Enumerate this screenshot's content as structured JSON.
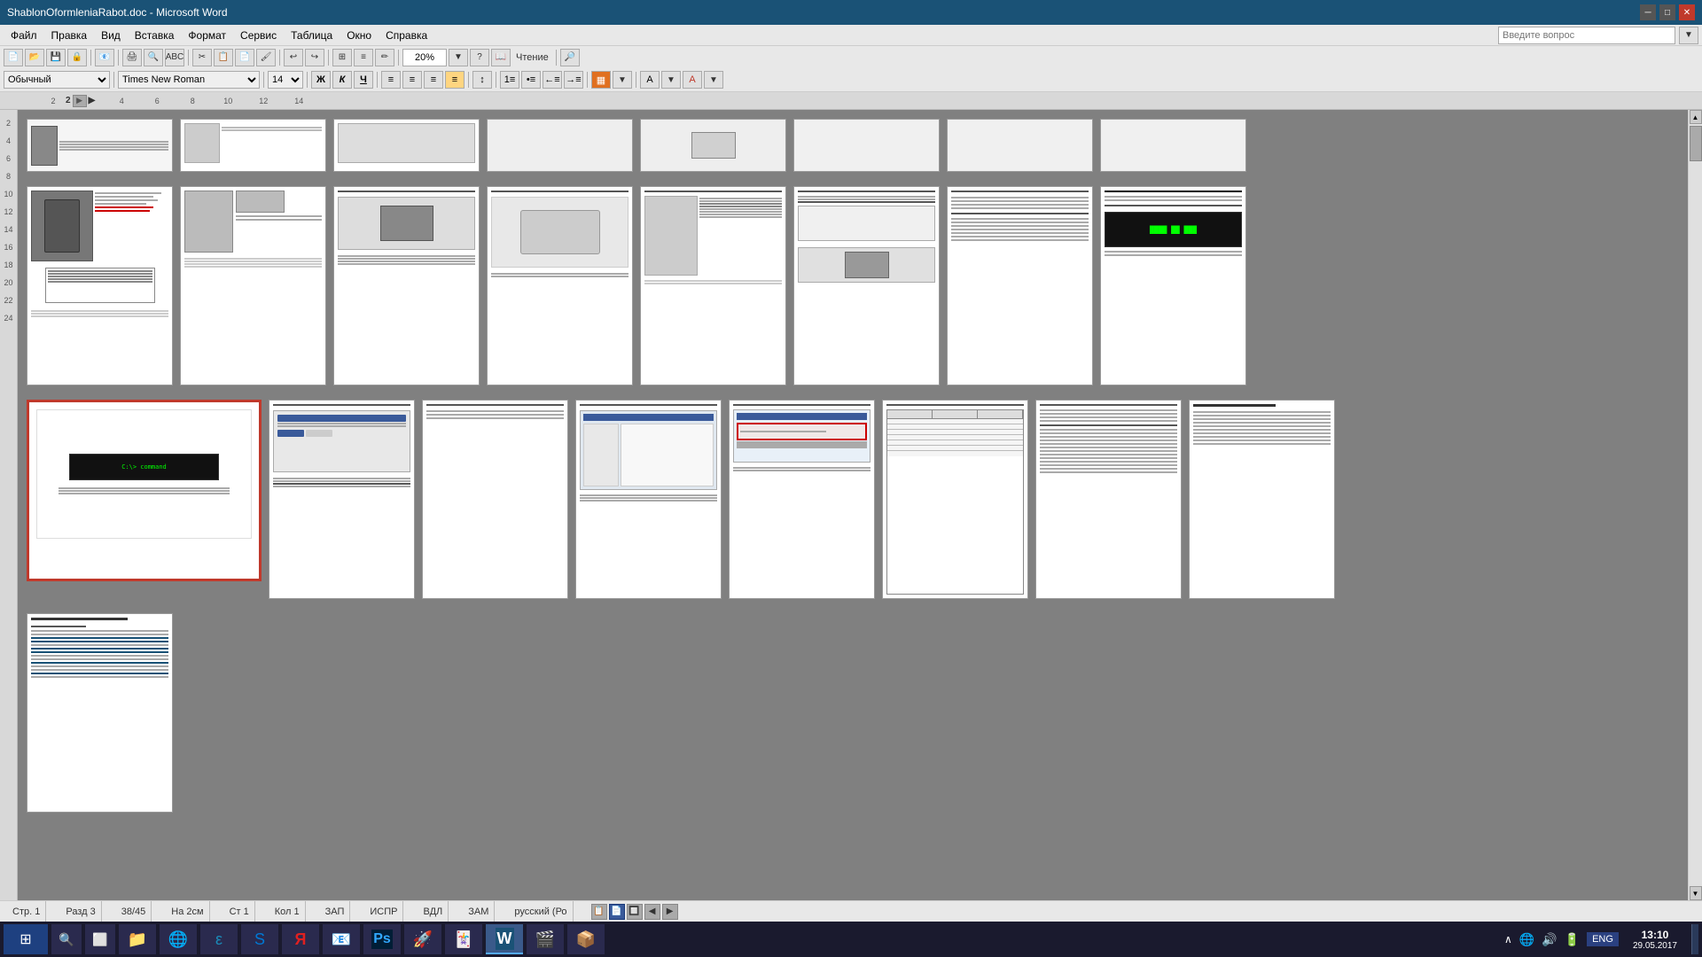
{
  "titlebar": {
    "title": "ShablonOformleniaRabot.doc - Microsoft Word",
    "minimize": "─",
    "restore": "□",
    "close": "✕"
  },
  "menubar": {
    "items": [
      "Файл",
      "Правка",
      "Вид",
      "Вставка",
      "Формат",
      "Сервис",
      "Таблица",
      "Окно",
      "Справка"
    ]
  },
  "toolbar": {
    "zoom": "20%",
    "mode": "Чтение",
    "style": "Обычный",
    "font": "Times New Roman",
    "size": "14",
    "question_placeholder": "Введите вопрос"
  },
  "ruler": {
    "marks": [
      "2",
      "4",
      "6",
      "8",
      "10",
      "12",
      "14"
    ]
  },
  "left_ruler": {
    "marks": [
      "2",
      "4",
      "6",
      "8",
      "10",
      "12",
      "14",
      "16",
      "18",
      "20",
      "22",
      "24"
    ]
  },
  "statusbar": {
    "page": "Стр. 1",
    "section": "Разд 3",
    "position": "38/45",
    "margin": "На 2см",
    "column1": "Ст 1",
    "column2": "Кол 1",
    "record": "ЗАП",
    "track": "ИСПР",
    "extend": "ВДЛ",
    "overwrite": "ЗАМ",
    "language": "русский (Ро"
  },
  "taskbar": {
    "start_icon": "⊞",
    "search_icon": "🔍",
    "taskview_icon": "⬜",
    "apps": [
      {
        "icon": "📁",
        "label": ""
      },
      {
        "icon": "🌐",
        "label": ""
      },
      {
        "icon": "⭐",
        "label": ""
      },
      {
        "icon": "💬",
        "label": ""
      },
      {
        "icon": "Y",
        "label": "",
        "color": "#e02020"
      },
      {
        "icon": "🗂",
        "label": ""
      },
      {
        "icon": "🖼",
        "label": ""
      },
      {
        "icon": "🎮",
        "label": ""
      },
      {
        "icon": "📋",
        "label": ""
      },
      {
        "icon": "W",
        "label": "",
        "color": "#1a5276",
        "active": true
      },
      {
        "icon": "🎬",
        "label": ""
      },
      {
        "icon": "📦",
        "label": ""
      }
    ],
    "time": "13:10",
    "date": "29.05.2017",
    "lang": "ENG"
  }
}
